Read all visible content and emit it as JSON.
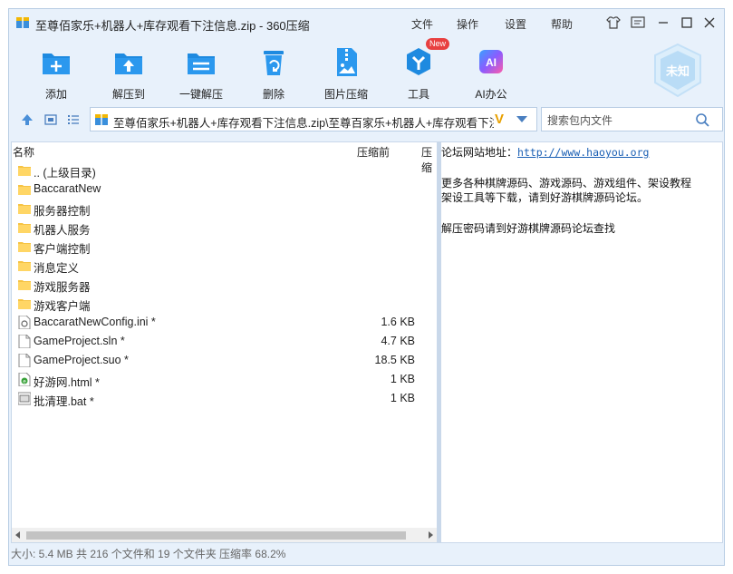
{
  "window": {
    "title": "至尊佰家乐+机器人+库存观看下注信息.zip - 360压缩",
    "menus": [
      "文件",
      "操作",
      "设置",
      "帮助"
    ]
  },
  "toolbar": {
    "items": [
      {
        "label": "添加",
        "icon": "add-icon"
      },
      {
        "label": "解压到",
        "icon": "extract-to-icon"
      },
      {
        "label": "一键解压",
        "icon": "one-click-extract-icon"
      },
      {
        "label": "删除",
        "icon": "delete-icon"
      },
      {
        "label": "图片压缩",
        "icon": "image-compress-icon"
      },
      {
        "label": "工具",
        "icon": "tools-icon",
        "badge": "New"
      },
      {
        "label": "AI办公",
        "icon": "ai-office-icon",
        "glyph": "AI"
      }
    ],
    "unknown_badge": "未知"
  },
  "address": {
    "path": "至尊佰家乐+机器人+库存观看下注信息.zip\\至尊百家乐+机器人+库存观看下注",
    "mark": "V"
  },
  "search": {
    "placeholder": "搜索包内文件"
  },
  "file_list": {
    "headers": {
      "name": "名称",
      "size_before": "压缩前",
      "size_after": "压缩"
    },
    "rows": [
      {
        "name": ".. (上级目录)",
        "size": "",
        "type": "folder"
      },
      {
        "name": "BaccaratNew",
        "size": "",
        "type": "folder"
      },
      {
        "name": "服务器控制",
        "size": "",
        "type": "folder"
      },
      {
        "name": "机器人服务",
        "size": "",
        "type": "folder"
      },
      {
        "name": "客户端控制",
        "size": "",
        "type": "folder"
      },
      {
        "name": "消息定义",
        "size": "",
        "type": "folder"
      },
      {
        "name": "游戏服务器",
        "size": "",
        "type": "folder"
      },
      {
        "name": "游戏客户端",
        "size": "",
        "type": "folder"
      },
      {
        "name": "BaccaratNewConfig.ini *",
        "size": "1.6 KB",
        "type": "ini"
      },
      {
        "name": "GameProject.sln *",
        "size": "4.7 KB",
        "type": "file"
      },
      {
        "name": "GameProject.suo *",
        "size": "18.5 KB",
        "type": "file"
      },
      {
        "name": "好游网.html *",
        "size": "1 KB",
        "type": "html"
      },
      {
        "name": "批清理.bat *",
        "size": "1 KB",
        "type": "bat"
      }
    ]
  },
  "notes": {
    "line1_prefix": "论坛网站地址：",
    "line1_link": "http://www.haoyou.org",
    "line2": "更多各种棋牌源码、游戏源码、游戏组件、架设教程",
    "line3": "架设工具等下载，请到好游棋牌源码论坛。",
    "line4": "解压密码请到好游棋牌源码论坛查找"
  },
  "status": {
    "text": "大小: 5.4 MB 共 216 个文件和 19 个文件夹 压缩率 68.2%"
  },
  "colors": {
    "window_bg": "#e8f1fb",
    "accent": "#1e8ae0",
    "link": "#1a5fb4"
  }
}
